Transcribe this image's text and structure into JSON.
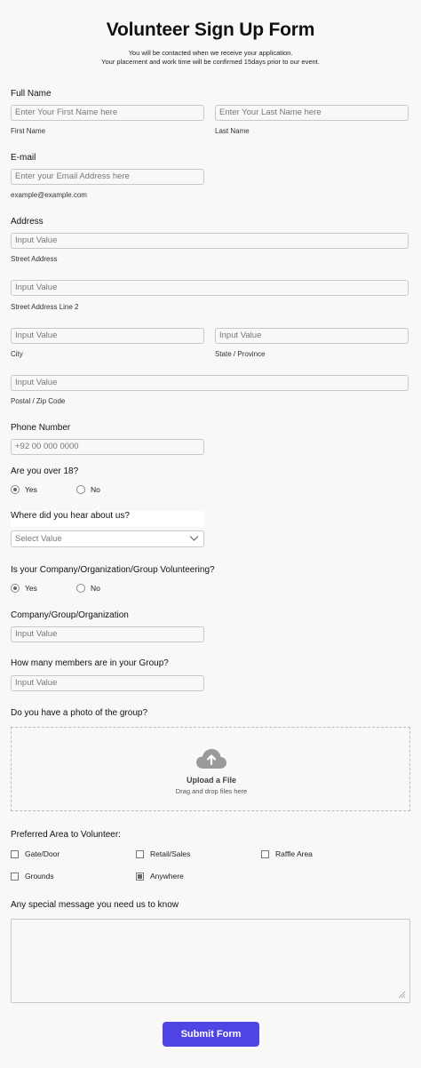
{
  "title": "Volunteer Sign Up Form",
  "subtitle_line1": "You will be contacted when we receive your application.",
  "subtitle_line2": "Your placement and work time will be confirmed 15days prior to our event.",
  "full_name": {
    "label": "Full Name",
    "first_placeholder": "Enter Your First Name here",
    "first_sublabel": "First Name",
    "last_placeholder": "Enter Your Last Name here",
    "last_sublabel": "Last Name"
  },
  "email": {
    "label": "E-mail",
    "placeholder": "Enter your Email Address here",
    "sublabel": "example@example.com"
  },
  "address": {
    "label": "Address",
    "street_placeholder": "Input Value",
    "street_sublabel": "Street Address",
    "street2_placeholder": "Input Value",
    "street2_sublabel": "Street Address Line 2",
    "city_placeholder": "Input Value",
    "city_sublabel": "City",
    "state_placeholder": "Input Value",
    "state_sublabel": "State / Province",
    "zip_placeholder": "Input Value",
    "zip_sublabel": "Postal / Zip Code"
  },
  "phone": {
    "label": "Phone Number",
    "placeholder": "+92 00 000 0000"
  },
  "over18": {
    "label": "Are you over 18?",
    "yes": "Yes",
    "no": "No",
    "selected": "Yes"
  },
  "hear": {
    "label": "Where did you hear about us?",
    "placeholder": "Select Value"
  },
  "group_volunteering": {
    "label": "Is your Company/Organization/Group Volunteering?",
    "yes": "Yes",
    "no": "No",
    "selected": "Yes"
  },
  "company": {
    "label": "Company/Group/Organization",
    "placeholder": "Input Value"
  },
  "members": {
    "label": "How many members are in your Group?",
    "placeholder": "Input Value"
  },
  "photo": {
    "label": "Do you have a photo of the group?",
    "upload_title": "Upload a File",
    "upload_sub": "Drag and drop files here",
    "icon": "cloud-upload-icon"
  },
  "area": {
    "label": "Preferred Area to Volunteer:",
    "options": [
      {
        "label": "Gate/Door",
        "checked": false
      },
      {
        "label": "Retail/Sales",
        "checked": false
      },
      {
        "label": "Raffle Area",
        "checked": false
      },
      {
        "label": "Grounds",
        "checked": false
      },
      {
        "label": "Anywhere",
        "checked": true
      }
    ]
  },
  "message": {
    "label": "Any special message you need us to know"
  },
  "submit_label": "Submit Form",
  "colors": {
    "accent": "#4e45e4",
    "background": "#f8f8f8",
    "border": "#c8c8c8"
  }
}
